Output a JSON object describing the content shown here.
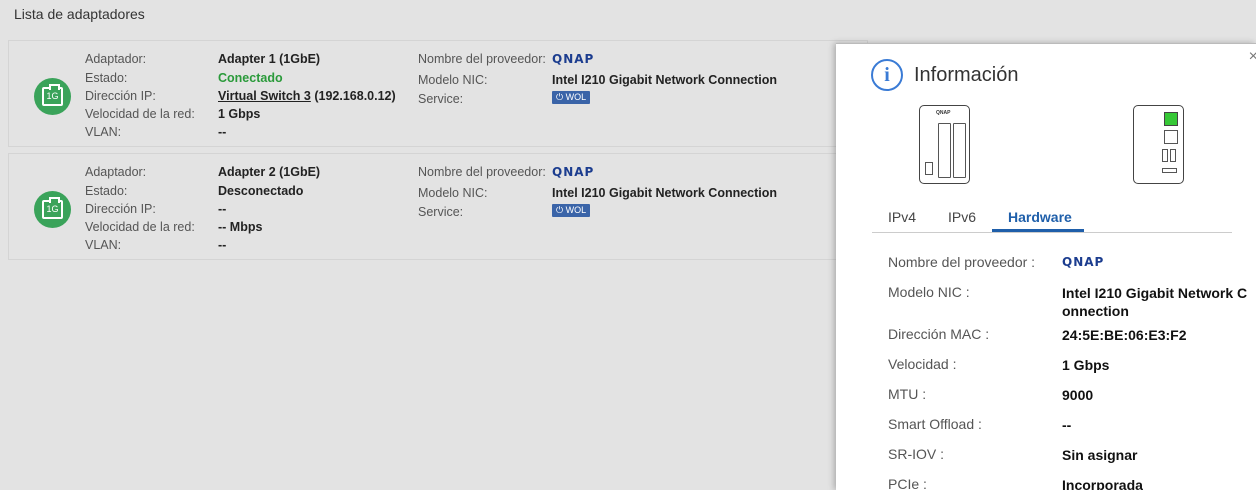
{
  "list": {
    "title": "Lista de adaptadores",
    "labels": {
      "adapter": "Adaptador:",
      "status": "Estado:",
      "ip": "Dirección IP:",
      "speed": "Velocidad de la red:",
      "vlan": "VLAN:",
      "vendor": "Nombre del proveedor:",
      "nic": "Modelo NIC:",
      "service": "Service:"
    },
    "adapters": [
      {
        "badge": "1G",
        "name": "Adapter 1 (1GbE)",
        "status": "Conectado",
        "ip_link": "Virtual Switch 3",
        "ip_suffix": "(192.168.0.12)",
        "speed": "1 Gbps",
        "vlan": "--",
        "vendor": "QNAP",
        "nic": "Intel I210 Gigabit Network Connection",
        "service": "⏻ WOL"
      },
      {
        "badge": "1G",
        "name": "Adapter 2 (1GbE)",
        "status": "Desconectado",
        "ip": "--",
        "speed": "-- Mbps",
        "vlan": "--",
        "vendor": "QNAP",
        "nic": "Intel I210 Gigabit Network Connection",
        "service": "⏻ WOL"
      }
    ]
  },
  "panel": {
    "title": "Información",
    "close": "×",
    "info_glyph": "i",
    "device_logo": "QNAP",
    "tabs": [
      "IPv4",
      "IPv6",
      "Hardware"
    ],
    "active_tab": "Hardware",
    "rows": [
      {
        "label": "Nombre del proveedor :",
        "value": "QNAP"
      },
      {
        "label": "Modelo NIC :",
        "value": "Intel I210 Gigabit Network Connection"
      },
      {
        "label": "Dirección MAC :",
        "value": "24:5E:BE:06:E3:F2"
      },
      {
        "label": "Velocidad :",
        "value": "1 Gbps"
      },
      {
        "label": "MTU :",
        "value": "9000"
      },
      {
        "label": "Smart Offload :",
        "value": "--"
      },
      {
        "label": "SR-IOV :",
        "value": "Sin asignar"
      },
      {
        "label": "PCIe :",
        "value": "Incorporada"
      }
    ]
  },
  "colors": {
    "accent": "#1f5faa",
    "connected": "#2a9a3a",
    "badge": "#3aa35a",
    "port_active": "#36c836"
  }
}
